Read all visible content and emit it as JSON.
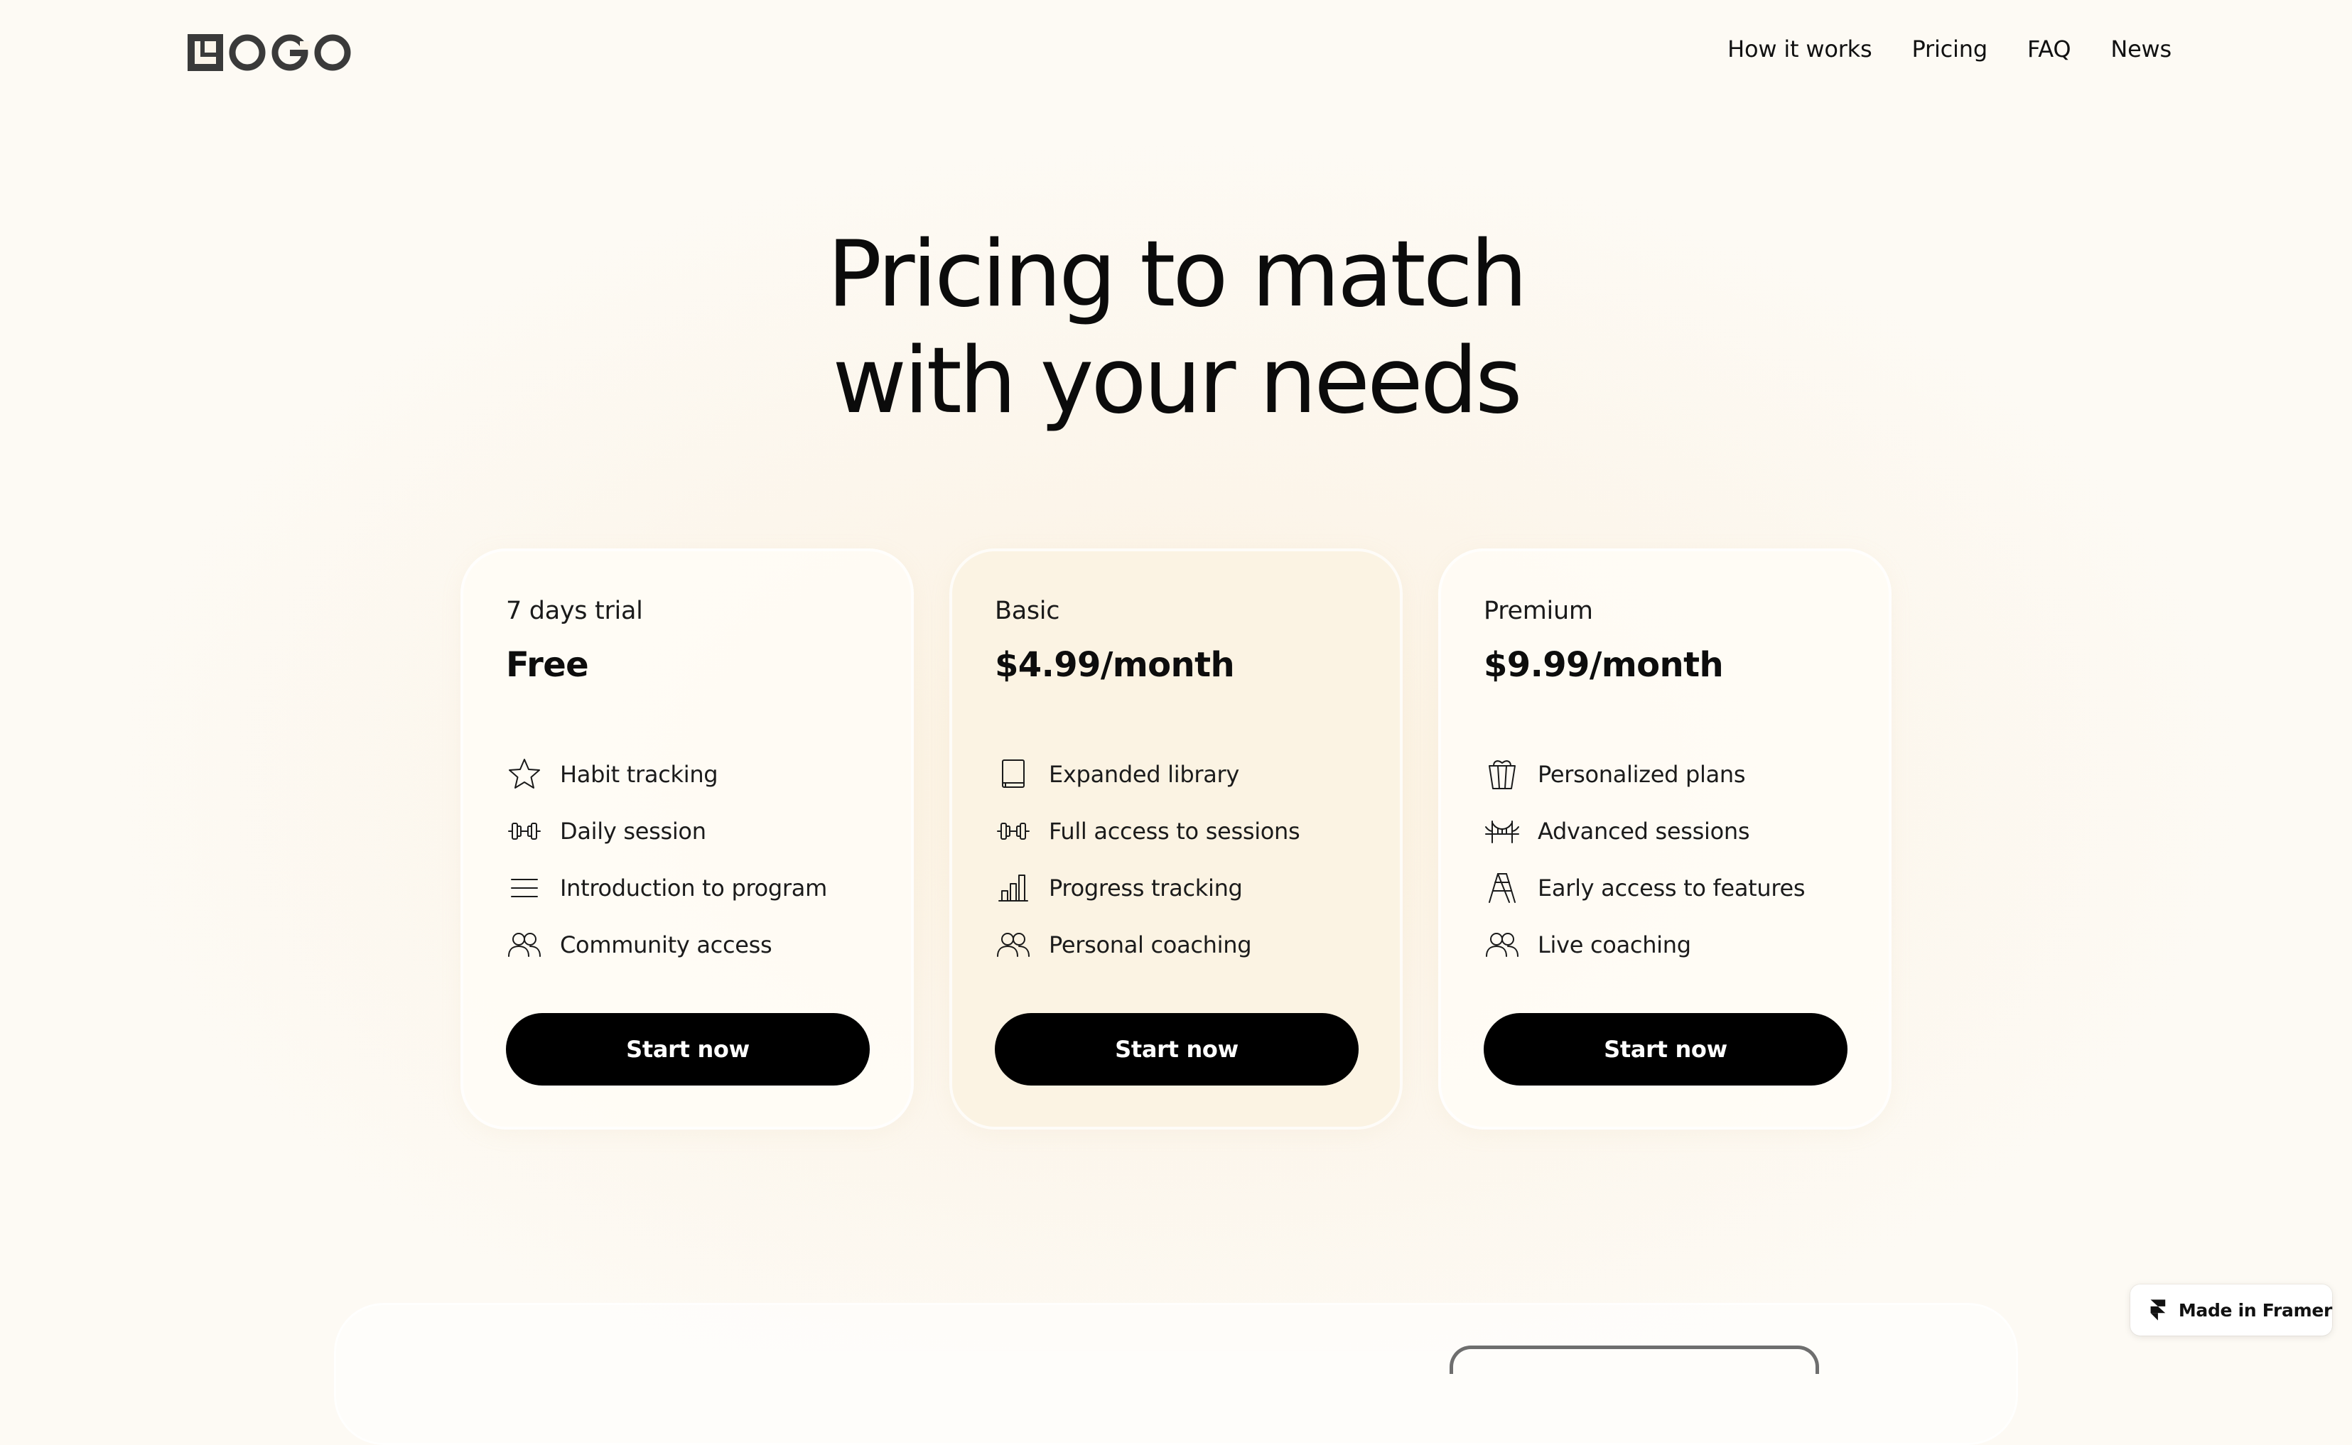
{
  "header": {
    "logo_alt": "LOGO",
    "nav": [
      {
        "label": "How it works"
      },
      {
        "label": "Pricing"
      },
      {
        "label": "FAQ"
      },
      {
        "label": "News"
      }
    ]
  },
  "hero": {
    "title_line1": "Pricing to match",
    "title_line2": "with your needs"
  },
  "plans": [
    {
      "name": "7 days trial",
      "price": "Free",
      "features": [
        {
          "label": "Habit tracking",
          "icon": "star-icon"
        },
        {
          "label": "Daily session",
          "icon": "dumbbell-icon"
        },
        {
          "label": "Introduction to program",
          "icon": "menu-lines-icon"
        },
        {
          "label": "Community access",
          "icon": "users-icon"
        }
      ],
      "cta": "Start now"
    },
    {
      "name": "Basic",
      "price": "$4.99/month",
      "features": [
        {
          "label": "Expanded library",
          "icon": "book-icon"
        },
        {
          "label": "Full access to sessions",
          "icon": "dumbbell-icon"
        },
        {
          "label": "Progress tracking",
          "icon": "bar-chart-icon"
        },
        {
          "label": "Personal coaching",
          "icon": "users-icon"
        }
      ],
      "cta": "Start now"
    },
    {
      "name": "Premium",
      "price": "$9.99/month",
      "features": [
        {
          "label": "Personalized  plans",
          "icon": "gift-basket-icon"
        },
        {
          "label": "Advanced sessions",
          "icon": "bridge-icon"
        },
        {
          "label": "Early access to features",
          "icon": "ladder-icon"
        },
        {
          "label": "Live coaching",
          "icon": "users-icon"
        }
      ],
      "cta": "Start now"
    }
  ],
  "badge": {
    "label": "Made in Framer",
    "icon": "framer-icon"
  },
  "colors": {
    "background": "#fcf5ea",
    "highlight_card": "#fbf3e3",
    "button": "#000000",
    "button_text": "#ffffff"
  }
}
